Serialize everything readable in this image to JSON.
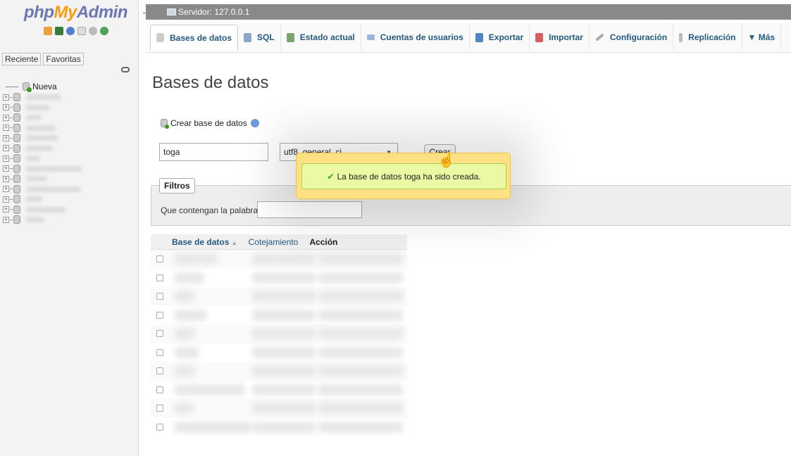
{
  "nav": {
    "logo": {
      "php": "php",
      "my": "My",
      "admin": "Admin"
    },
    "tabs": [
      "Reciente",
      "Favoritas"
    ],
    "tree_new": "Nueva",
    "tree_item_count": 13
  },
  "server": {
    "label": "Servidor: 127.0.0.1"
  },
  "tabs": [
    {
      "label": "Bases de datos",
      "icon": "database-icon",
      "active": true
    },
    {
      "label": "SQL",
      "icon": "sql-icon"
    },
    {
      "label": "Estado actual",
      "icon": "status-icon"
    },
    {
      "label": "Cuentas de usuarios",
      "icon": "users-icon"
    },
    {
      "label": "Exportar",
      "icon": "export-icon"
    },
    {
      "label": "Importar",
      "icon": "import-icon"
    },
    {
      "label": "Configuración",
      "icon": "wrench-icon"
    },
    {
      "label": "Replicación",
      "icon": "replication-icon"
    },
    {
      "label": "▼ Más",
      "icon": ""
    }
  ],
  "main": {
    "title": "Bases de datos",
    "create_label": "Crear base de datos",
    "db_name_value": "toga",
    "collation_value": "utf8_general_ci",
    "create_button": "Crear",
    "filters_legend": "Filtros",
    "filter_label": "Que contengan la palabra:",
    "filter_value": "",
    "success_message": "La base de datos toga ha sido creada."
  },
  "table": {
    "headers": [
      "Base de datos",
      "Cotejamiento",
      "Acción"
    ],
    "sort_indicator": "▲",
    "row_count": 10
  },
  "colors": {
    "link": "#235a81",
    "server_bar": "#898989",
    "popup_bg": "#ffe082",
    "success_bg": "#ebf8a4"
  }
}
